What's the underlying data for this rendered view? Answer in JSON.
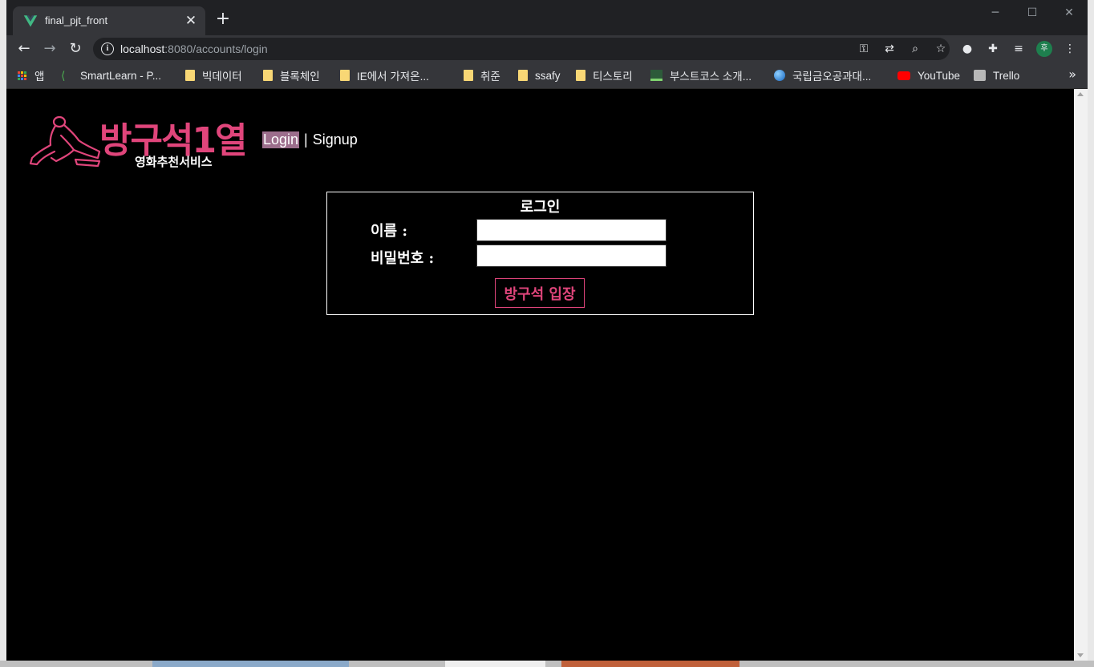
{
  "browser": {
    "tab_title": "final_pjt_front",
    "url_host": "localhost",
    "url_path": ":8080/accounts/login",
    "profile_initial": "후",
    "accent_color": "#e0457b"
  },
  "bookmarks": [
    {
      "label": "앱",
      "icon": "apps-grid-icon"
    },
    {
      "label": "SmartLearn - P...",
      "icon": "smartlearn-icon"
    },
    {
      "label": "빅데이터",
      "icon": "folder-icon"
    },
    {
      "label": "블록체인",
      "icon": "folder-icon"
    },
    {
      "label": "IE에서 가져온...",
      "icon": "folder-icon"
    },
    {
      "label": "취준",
      "icon": "folder-icon"
    },
    {
      "label": "ssafy",
      "icon": "folder-icon"
    },
    {
      "label": "티스토리",
      "icon": "folder-icon"
    },
    {
      "label": "부스트코스 소개...",
      "icon": "boostcourse-icon"
    },
    {
      "label": "국립금오공과대...",
      "icon": "globe-icon"
    },
    {
      "label": "YouTube",
      "icon": "youtube-icon"
    },
    {
      "label": "Trello",
      "icon": "trello-icon"
    }
  ],
  "page": {
    "logo_title": "방구석1열",
    "logo_subtitle": "영화추천서비스",
    "nav_login": "Login",
    "nav_separator": "|",
    "nav_signup": "Signup",
    "form_title": "로그인",
    "username_label": "이름 :",
    "password_label": "비밀번호 :",
    "username_value": "",
    "password_value": "",
    "submit_label": "방구석 입장"
  }
}
